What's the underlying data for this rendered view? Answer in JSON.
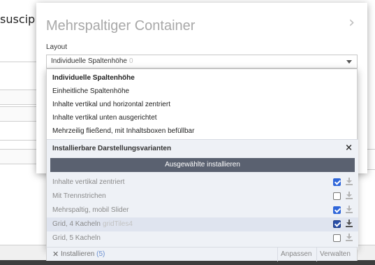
{
  "background": {
    "text": "suscip"
  },
  "popup": {
    "title": "Mehrspaltiger Container",
    "chevron": "›",
    "field_label": "Layout",
    "select_value": "Individuelle Spaltenhöhe",
    "select_count": "0"
  },
  "dropdown": {
    "options": [
      "Individuelle Spaltenhöhe",
      "Einheitliche Spaltenhöhe",
      "Inhalte vertikal und horizontal zentriert",
      "Inhalte vertikal unten ausgerichtet",
      "Mehrzeilig fließend, mit Inhaltsboxen befüllbar"
    ],
    "selected_index": 0
  },
  "variants": {
    "heading": "Installierbare Darstellungsvarianten",
    "close": "×",
    "install_button": "Ausgewählte installieren",
    "items": [
      {
        "label": "Inhalte vertikal zentriert",
        "tech": "",
        "checked": true
      },
      {
        "label": "Mit Trennstrichen",
        "tech": "",
        "checked": false
      },
      {
        "label": "Mehrspaltig, mobil Slider",
        "tech": "",
        "checked": true
      },
      {
        "label": "Grid, 4 Kacheln",
        "tech": "gridTiles4",
        "checked": true
      },
      {
        "label": "Grid, 5 Kacheln",
        "tech": "",
        "checked": false
      }
    ],
    "footer": {
      "x": "✕",
      "label": "Installieren",
      "count": "(5)",
      "adjust": "Anpassen",
      "manage": "Verwalten"
    }
  },
  "icons": {
    "close": "close-icon",
    "chevron": "chevron-right-icon",
    "caret": "chevron-down-icon",
    "download": "download-icon",
    "checkbox": "checkbox-icon"
  },
  "colors": {
    "install_button": "#5a6170",
    "checkbox_checked": "#2f66d9",
    "variants_bg": "#eef1f6",
    "highlight_row": "#dfe4ef"
  }
}
